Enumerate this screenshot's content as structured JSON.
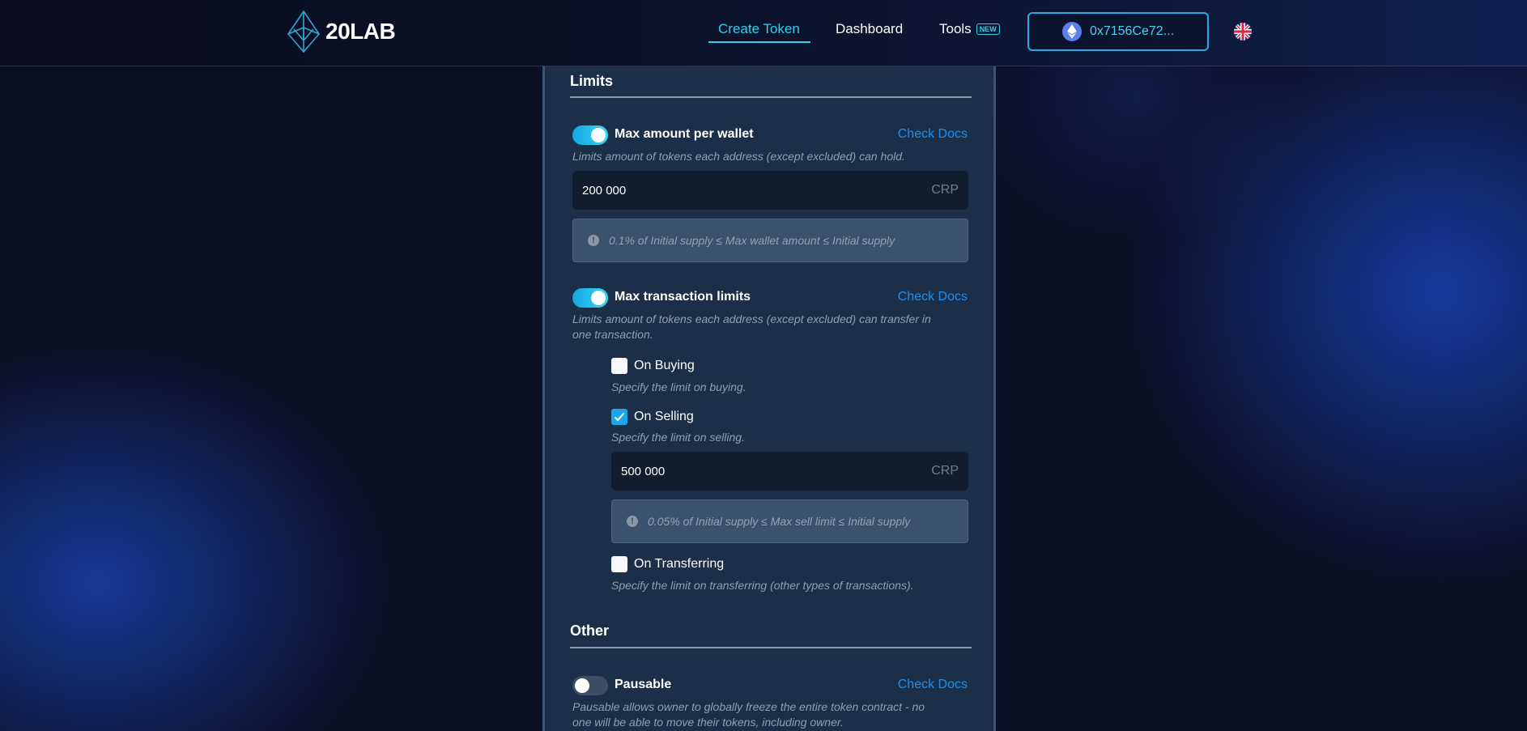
{
  "nav": {
    "logo_text": "20LAB",
    "links": [
      {
        "label": "Create Token"
      },
      {
        "label": "Dashboard"
      },
      {
        "label": "Tools",
        "badge": "NEW"
      }
    ],
    "wallet_address": "0x7156Ce72...",
    "accent_color": "#2ed1e8",
    "language_icon": "uk-flag-icon"
  },
  "limits": {
    "title": "Limits",
    "max_wallet": {
      "label": "Max amount per wallet",
      "enabled": true,
      "docs_label": "Check Docs",
      "description": "Limits amount of tokens each address (except excluded) can hold.",
      "value": "200 000",
      "unit": "CRP",
      "note": "0.1% of Initial supply ≤ Max wallet amount ≤ Initial supply"
    },
    "max_tx": {
      "label": "Max transaction limits",
      "enabled": true,
      "docs_label": "Check Docs",
      "description_line1": "Limits amount of tokens each address (except excluded) can transfer in",
      "description_line2": "one transaction.",
      "on_buying": {
        "label": "On Buying",
        "checked": false,
        "description": "Specify the limit on buying."
      },
      "on_selling": {
        "label": "On Selling",
        "checked": true,
        "description": "Specify the limit on selling.",
        "value": "500 000",
        "unit": "CRP",
        "note": "0.05% of Initial supply ≤ Max sell limit ≤ Initial supply"
      },
      "on_transferring": {
        "label": "On Transferring",
        "checked": false,
        "description": "Specify the limit on transferring (other types of transactions)."
      }
    }
  },
  "other": {
    "title": "Other",
    "pausable": {
      "label": "Pausable",
      "enabled": false,
      "docs_label": "Check Docs",
      "description_line1": "Pausable allows owner to globally freeze the entire token contract - no",
      "description_line2": "one will be able to move their tokens, including owner."
    }
  }
}
